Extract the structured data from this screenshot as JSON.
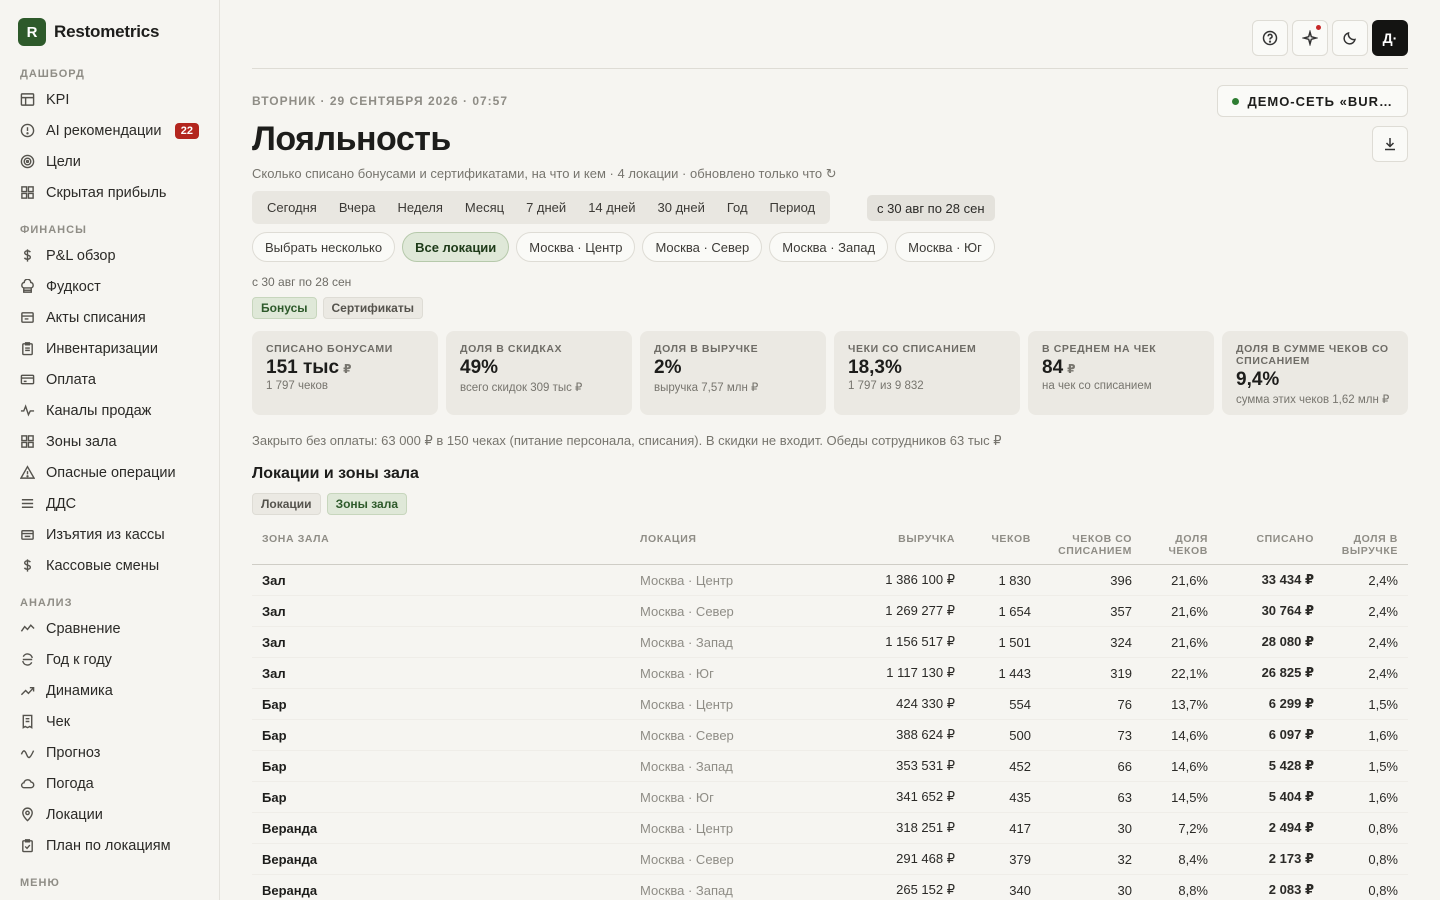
{
  "brand": {
    "logo_letter": "R",
    "name": "Restometrics"
  },
  "sidebar": {
    "sections": [
      {
        "title": "ДАШБОРД",
        "items": [
          {
            "label": "KPI",
            "icon": "table-icon"
          },
          {
            "label": "AI рекомендации",
            "icon": "alert-circle-icon",
            "badge": "22"
          },
          {
            "label": "Цели",
            "icon": "target-icon"
          },
          {
            "label": "Скрытая прибыль",
            "icon": "grid-icon"
          }
        ]
      },
      {
        "title": "ФИНАНСЫ",
        "items": [
          {
            "label": "P&L обзор",
            "icon": "dollar-icon"
          },
          {
            "label": "Фудкост",
            "icon": "chef-icon"
          },
          {
            "label": "Акты списания",
            "icon": "document-icon"
          },
          {
            "label": "Инвентаризации",
            "icon": "clipboard-icon"
          },
          {
            "label": "Оплата",
            "icon": "card-icon"
          },
          {
            "label": "Каналы продаж",
            "icon": "pulse-icon"
          },
          {
            "label": "Зоны зала",
            "icon": "grid-icon"
          },
          {
            "label": "Опасные операции",
            "icon": "warning-icon"
          },
          {
            "label": "ДДС",
            "icon": "menu-icon"
          },
          {
            "label": "Изъятия из кассы",
            "icon": "register-icon"
          },
          {
            "label": "Кассовые смены",
            "icon": "dollar-icon"
          }
        ]
      },
      {
        "title": "АНАЛИЗ",
        "items": [
          {
            "label": "Сравнение",
            "icon": "compare-icon"
          },
          {
            "label": "Год к году",
            "icon": "cycle-icon"
          },
          {
            "label": "Динамика",
            "icon": "trend-icon"
          },
          {
            "label": "Чек",
            "icon": "receipt-icon"
          },
          {
            "label": "Прогноз",
            "icon": "wave-icon"
          },
          {
            "label": "Погода",
            "icon": "cloud-icon"
          },
          {
            "label": "Локации",
            "icon": "pin-icon"
          },
          {
            "label": "План по локациям",
            "icon": "clipboard-check-icon"
          }
        ]
      },
      {
        "title": "МЕНЮ",
        "items": []
      }
    ]
  },
  "topbar": {
    "avatar_text": "Д·"
  },
  "header": {
    "date_line": "ВТОРНИК · 29 СЕНТЯБРЯ 2026 · 07:57",
    "network_chip": "ДЕМО-СЕТЬ «BUR…",
    "title": "Лояльность",
    "subtitle": "Сколько списано бонусами и сертификатами, на что и кем · 4 локации · обновлено только что  ↻"
  },
  "periods": [
    "Сегодня",
    "Вчера",
    "Неделя",
    "Месяц",
    "7 дней",
    "14 дней",
    "30 дней",
    "Год",
    "Период"
  ],
  "period_range": "с 30 авг по 28 сен",
  "locations": [
    {
      "label": "Выбрать несколько",
      "active": false
    },
    {
      "label": "Все локации",
      "active": true
    },
    {
      "label": "Москва · Центр",
      "active": false
    },
    {
      "label": "Москва · Север",
      "active": false
    },
    {
      "label": "Москва · Запад",
      "active": false
    },
    {
      "label": "Москва · Юг",
      "active": false
    }
  ],
  "range_note": "с 30 авг по 28 сен",
  "type_toggle": [
    {
      "label": "Бонусы",
      "active": true
    },
    {
      "label": "Сертификаты",
      "active": false
    }
  ],
  "kpis": [
    {
      "label": "СПИСАНО БОНУСАМИ",
      "value": "151 тыс",
      "unit": "₽",
      "sub": "1 797 чеков"
    },
    {
      "label": "ДОЛЯ В СКИДКАХ",
      "value": "49%",
      "unit": "",
      "sub": "всего скидок 309 тыс ₽"
    },
    {
      "label": "ДОЛЯ В ВЫРУЧКЕ",
      "value": "2%",
      "unit": "",
      "sub": "выручка 7,57 млн ₽"
    },
    {
      "label": "ЧЕКИ СО СПИСАНИЕМ",
      "value": "18,3%",
      "unit": "",
      "sub": "1 797 из 9 832"
    },
    {
      "label": "В СРЕДНЕМ НА ЧЕК",
      "value": "84",
      "unit": "₽",
      "sub": "на чек со списанием"
    },
    {
      "label": "ДОЛЯ В СУММЕ ЧЕКОВ СО СПИСАНИЕМ",
      "value": "9,4%",
      "unit": "",
      "sub": "сумма этих чеков 1,62 млн ₽"
    }
  ],
  "note": "Закрыто без оплаты: 63 000 ₽ в 150 чеках (питание персонала, списания). В скидки не входит. Обеды сотрудников 63 тыс ₽",
  "section_title": "Локации и зоны зала",
  "view_toggle": [
    {
      "label": "Локации",
      "active": false
    },
    {
      "label": "Зоны зала",
      "active": true
    }
  ],
  "table": {
    "headers": [
      "ЗОНА ЗАЛА",
      "ЛОКАЦИЯ",
      "ВЫРУЧКА",
      "ЧЕКОВ",
      "ЧЕКОВ СО СПИСАНИЕМ",
      "ДОЛЯ ЧЕКОВ",
      "СПИСАНО",
      "ДОЛЯ В ВЫРУЧКЕ"
    ],
    "rows": [
      [
        "Зал",
        "Москва · Центр",
        "1 386 100 ₽",
        "1 830",
        "396",
        "21,6%",
        "33 434 ₽",
        "2,4%"
      ],
      [
        "Зал",
        "Москва · Север",
        "1 269 277 ₽",
        "1 654",
        "357",
        "21,6%",
        "30 764 ₽",
        "2,4%"
      ],
      [
        "Зал",
        "Москва · Запад",
        "1 156 517 ₽",
        "1 501",
        "324",
        "21,6%",
        "28 080 ₽",
        "2,4%"
      ],
      [
        "Зал",
        "Москва · Юг",
        "1 117 130 ₽",
        "1 443",
        "319",
        "22,1%",
        "26 825 ₽",
        "2,4%"
      ],
      [
        "Бар",
        "Москва · Центр",
        "424 330 ₽",
        "554",
        "76",
        "13,7%",
        "6 299 ₽",
        "1,5%"
      ],
      [
        "Бар",
        "Москва · Север",
        "388 624 ₽",
        "500",
        "73",
        "14,6%",
        "6 097 ₽",
        "1,6%"
      ],
      [
        "Бар",
        "Москва · Запад",
        "353 531 ₽",
        "452",
        "66",
        "14,6%",
        "5 428 ₽",
        "1,5%"
      ],
      [
        "Бар",
        "Москва · Юг",
        "341 652 ₽",
        "435",
        "63",
        "14,5%",
        "5 404 ₽",
        "1,6%"
      ],
      [
        "Веранда",
        "Москва · Центр",
        "318 251 ₽",
        "417",
        "30",
        "7,2%",
        "2 494 ₽",
        "0,8%"
      ],
      [
        "Веранда",
        "Москва · Север",
        "291 468 ₽",
        "379",
        "32",
        "8,4%",
        "2 173 ₽",
        "0,8%"
      ],
      [
        "Веранда",
        "Москва · Запад",
        "265 152 ₽",
        "340",
        "30",
        "8,8%",
        "2 083 ₽",
        "0,8%"
      ]
    ]
  }
}
